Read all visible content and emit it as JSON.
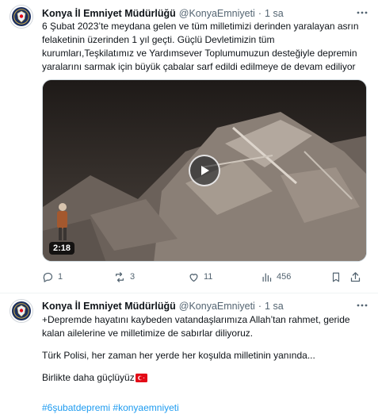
{
  "tweets": [
    {
      "author": "Konya İl Emniyet Müdürlüğü",
      "handle": "@KonyaEmniyeti",
      "separator": "·",
      "time": "1 sa",
      "text": "6 Şubat 2023’te meydana gelen ve tüm milletimizi derinden yaralayan asrın felaketinin üzerinden 1 yıl geçti. Güçlü Devletimizin tüm kurumları,Teşkilatımız ve Yardımsever Toplumumuzun desteğiyle depremin yaralarını sarmak için büyük çabalar sarf edildi edilmeye de devam ediliyor",
      "media": {
        "type": "video",
        "duration": "2:18"
      },
      "actions": {
        "replies": "1",
        "retweets": "3",
        "likes": "11",
        "views": "456"
      }
    },
    {
      "author": "Konya İl Emniyet Müdürlüğü",
      "handle": "@KonyaEmniyeti",
      "separator": "·",
      "time": "1 sa",
      "paragraphs": [
        "+Depremde hayatını kaybeden vatandaşlarımıza Allah’tan rahmet, geride kalan ailelerine ve milletimize de sabırlar diliyoruz.",
        "Türk Polisi, her zaman her yerde her koşulda milletinin yanında...",
        "Birlikte daha güçlüyüz"
      ],
      "hashtags": [
        "#6şubatdepremi",
        "#konyaemniyeti"
      ]
    }
  ],
  "icons": {
    "more": "more-icon",
    "reply": "reply-icon",
    "retweet": "retweet-icon",
    "like": "like-icon",
    "views": "views-icon",
    "bookmark": "bookmark-icon",
    "share": "share-icon",
    "flag": "turkish-flag-icon"
  },
  "colors": {
    "text": "#0f1419",
    "secondary": "#536471",
    "link": "#1d9bf0",
    "divider": "#eff3f4",
    "flag_red": "#e30a17"
  }
}
